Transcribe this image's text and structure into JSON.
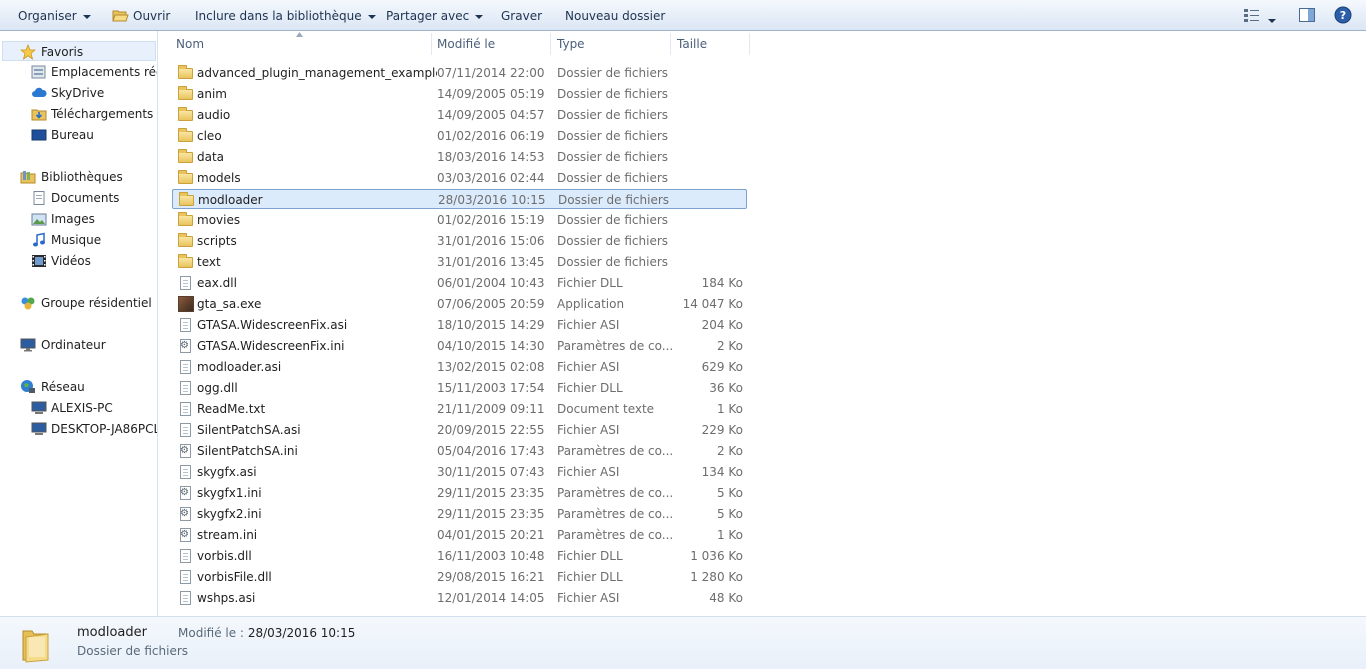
{
  "toolbar": {
    "organize": "Organiser",
    "open": "Ouvrir",
    "include_library": "Inclure dans la bibliothèque",
    "share_with": "Partager avec",
    "burn": "Graver",
    "new_folder": "Nouveau dossier"
  },
  "sidebar": {
    "favorites": "Favoris",
    "recent_places": "Emplacements récents",
    "skydrive": "SkyDrive",
    "downloads": "Téléchargements",
    "desktop": "Bureau",
    "libraries": "Bibliothèques",
    "documents": "Documents",
    "images": "Images",
    "music": "Musique",
    "videos": "Vidéos",
    "homegroup": "Groupe résidentiel",
    "computer": "Ordinateur",
    "network": "Réseau",
    "net_pc1": "ALEXIS-PC",
    "net_pc2": "DESKTOP-JA86PCL"
  },
  "columns": {
    "name": "Nom",
    "date": "Modifié le",
    "type": "Type",
    "size": "Taille"
  },
  "files": [
    {
      "icon": "folder",
      "name": "advanced_plugin_management_example",
      "date": "07/11/2014 22:00",
      "type": "Dossier de fichiers",
      "size": ""
    },
    {
      "icon": "folder",
      "name": "anim",
      "date": "14/09/2005 05:19",
      "type": "Dossier de fichiers",
      "size": ""
    },
    {
      "icon": "folder",
      "name": "audio",
      "date": "14/09/2005 04:57",
      "type": "Dossier de fichiers",
      "size": ""
    },
    {
      "icon": "folder",
      "name": "cleo",
      "date": "01/02/2016 06:19",
      "type": "Dossier de fichiers",
      "size": ""
    },
    {
      "icon": "folder",
      "name": "data",
      "date": "18/03/2016 14:53",
      "type": "Dossier de fichiers",
      "size": ""
    },
    {
      "icon": "folder",
      "name": "models",
      "date": "03/03/2016 02:44",
      "type": "Dossier de fichiers",
      "size": ""
    },
    {
      "icon": "folder",
      "name": "modloader",
      "date": "28/03/2016 10:15",
      "type": "Dossier de fichiers",
      "size": "",
      "selected": true
    },
    {
      "icon": "folder",
      "name": "movies",
      "date": "01/02/2016 15:19",
      "type": "Dossier de fichiers",
      "size": ""
    },
    {
      "icon": "folder",
      "name": "scripts",
      "date": "31/01/2016 15:06",
      "type": "Dossier de fichiers",
      "size": ""
    },
    {
      "icon": "folder",
      "name": "text",
      "date": "31/01/2016 13:45",
      "type": "Dossier de fichiers",
      "size": ""
    },
    {
      "icon": "file",
      "name": "eax.dll",
      "date": "06/01/2004 10:43",
      "type": "Fichier DLL",
      "size": "184 Ko"
    },
    {
      "icon": "exe",
      "name": "gta_sa.exe",
      "date": "07/06/2005 20:59",
      "type": "Application",
      "size": "14 047 Ko"
    },
    {
      "icon": "file",
      "name": "GTASA.WidescreenFix.asi",
      "date": "18/10/2015 14:29",
      "type": "Fichier ASI",
      "size": "204 Ko"
    },
    {
      "icon": "ini",
      "name": "GTASA.WidescreenFix.ini",
      "date": "04/10/2015 14:30",
      "type": "Paramètres de co...",
      "size": "2 Ko"
    },
    {
      "icon": "file",
      "name": "modloader.asi",
      "date": "13/02/2015 02:08",
      "type": "Fichier ASI",
      "size": "629 Ko"
    },
    {
      "icon": "file",
      "name": "ogg.dll",
      "date": "15/11/2003 17:54",
      "type": "Fichier DLL",
      "size": "36 Ko"
    },
    {
      "icon": "file",
      "name": "ReadMe.txt",
      "date": "21/11/2009 09:11",
      "type": "Document texte",
      "size": "1 Ko"
    },
    {
      "icon": "file",
      "name": "SilentPatchSA.asi",
      "date": "20/09/2015 22:55",
      "type": "Fichier ASI",
      "size": "229 Ko"
    },
    {
      "icon": "ini",
      "name": "SilentPatchSA.ini",
      "date": "05/04/2016 17:43",
      "type": "Paramètres de co...",
      "size": "2 Ko"
    },
    {
      "icon": "file",
      "name": "skygfx.asi",
      "date": "30/11/2015 07:43",
      "type": "Fichier ASI",
      "size": "134 Ko"
    },
    {
      "icon": "ini",
      "name": "skygfx1.ini",
      "date": "29/11/2015 23:35",
      "type": "Paramètres de co...",
      "size": "5 Ko"
    },
    {
      "icon": "ini",
      "name": "skygfx2.ini",
      "date": "29/11/2015 23:35",
      "type": "Paramètres de co...",
      "size": "5 Ko"
    },
    {
      "icon": "ini",
      "name": "stream.ini",
      "date": "04/01/2015 20:21",
      "type": "Paramètres de co...",
      "size": "1 Ko"
    },
    {
      "icon": "file",
      "name": "vorbis.dll",
      "date": "16/11/2003 10:48",
      "type": "Fichier DLL",
      "size": "1 036 Ko"
    },
    {
      "icon": "file",
      "name": "vorbisFile.dll",
      "date": "29/08/2015 16:21",
      "type": "Fichier DLL",
      "size": "1 280 Ko"
    },
    {
      "icon": "file",
      "name": "wshps.asi",
      "date": "12/01/2014 14:05",
      "type": "Fichier ASI",
      "size": "48 Ko"
    }
  ],
  "details": {
    "name": "modloader",
    "modified_label": "Modifié le :",
    "modified_value": "28/03/2016 10:15",
    "type": "Dossier de fichiers"
  }
}
